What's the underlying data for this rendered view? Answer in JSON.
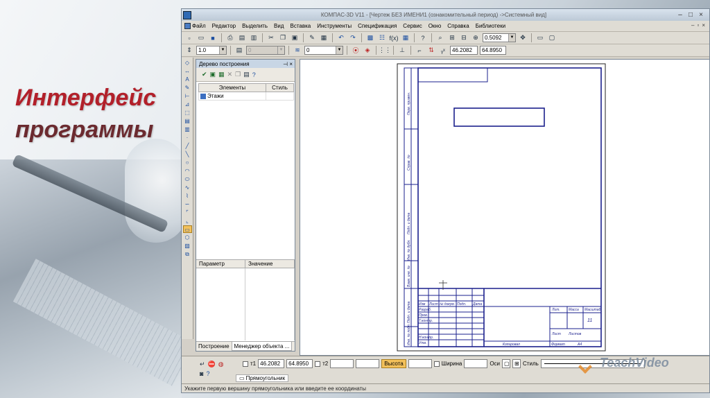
{
  "slide": {
    "title_line1": "Интерфейс",
    "title_line2": "программы",
    "watermark": "TeachVideo"
  },
  "window": {
    "title": "КОМПАС-3D V11 - [Чертеж БЕЗ ИМЕНИ1 (ознакомительный период) ->Системный вид]"
  },
  "menu": {
    "items": [
      "Файл",
      "Редактор",
      "Выделить",
      "Вид",
      "Вставка",
      "Инструменты",
      "Спецификация",
      "Сервис",
      "Окно",
      "Справка",
      "Библиотеки"
    ]
  },
  "toolbar": {
    "zoom_value": "0.5092",
    "scale_value": "1.0",
    "layer_value": "0",
    "state_value": "0",
    "coord_x": "46.2082",
    "coord_y": "64.8950"
  },
  "tree_panel": {
    "title": "Дерево построения",
    "col_elements": "Элементы",
    "col_style": "Стиль",
    "node_label": "Этажи",
    "param_label": "Параметр",
    "value_label": "Значение",
    "tab_build": "Построение",
    "tab_manager": "Менеджер объекта ..."
  },
  "propbar": {
    "t1_label": "т1",
    "t1_x": "46.2082",
    "t1_y": "64.8950",
    "t2_label": "т2",
    "height_label": "Высота",
    "width_label": "Ширина",
    "axes_label": "Оси",
    "style_label": "Стиль",
    "tab_label": "Прямоугольник"
  },
  "status": {
    "text": "Укажите первую вершину прямоугольника или введите ее координаты"
  },
  "drawing": {
    "title_block": {
      "lit": "Лит.",
      "mass": "Масса",
      "scale": "Масштаб",
      "sheet": "Лист",
      "sheets": "Листов",
      "sheets_count": "11",
      "copied": "Копировал",
      "format": "Формат",
      "format_value": "A4",
      "izm": "Изм",
      "list": "Лист",
      "doc_no": "№ докум.",
      "sign": "Подп.",
      "date": "Дата",
      "developed": "Разраб.",
      "checked": "Пров.",
      "t_contr": "Т.контр.",
      "n_contr": "Н.контр.",
      "approved": "Утв."
    },
    "side_labels": [
      "Перв. примен.",
      "Справ. №",
      "Подп. и дата",
      "Инв. № дубл.",
      "Взам. инв. №",
      "Подп. и дата",
      "Инв. № подл."
    ]
  }
}
